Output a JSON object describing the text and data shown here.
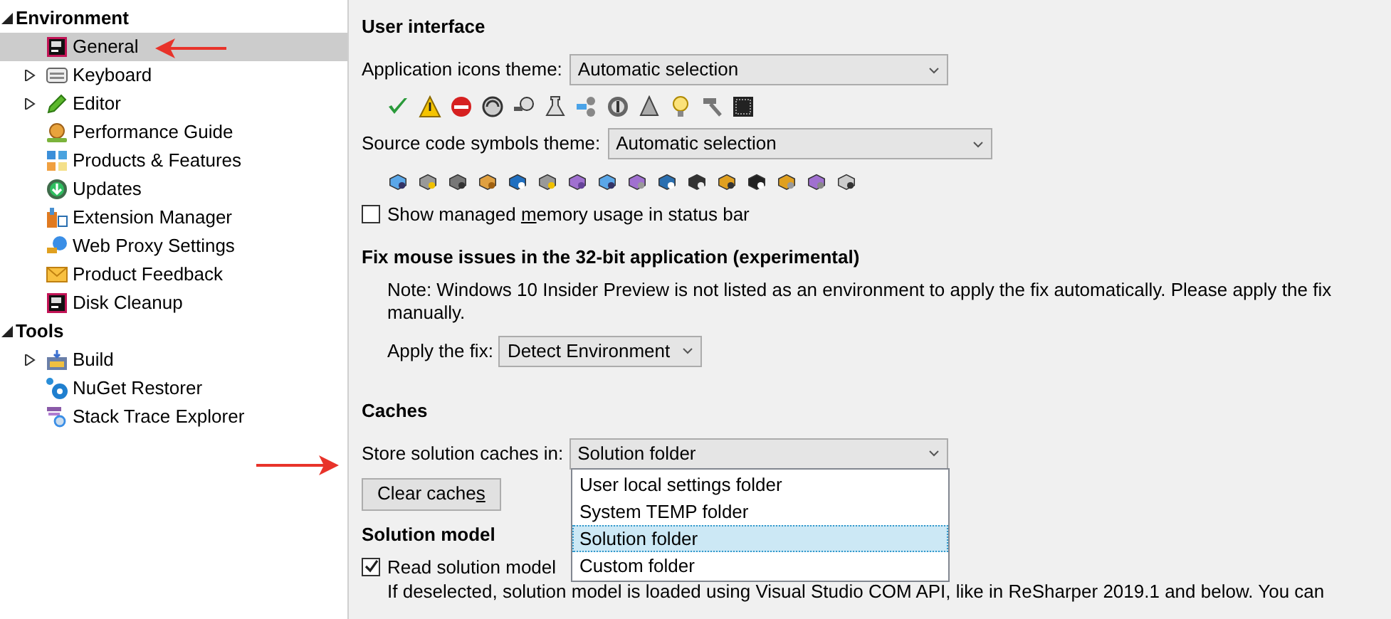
{
  "sidebar": {
    "groups": [
      {
        "label": "Environment",
        "expanded": true,
        "items": [
          {
            "label": "General",
            "selected": true
          },
          {
            "label": "Keyboard",
            "expanded": false,
            "selected": false
          },
          {
            "label": "Editor",
            "expanded": false,
            "selected": false
          },
          {
            "label": "Performance Guide",
            "selected": false
          },
          {
            "label": "Products & Features",
            "selected": false
          },
          {
            "label": "Updates",
            "selected": false
          },
          {
            "label": "Extension Manager",
            "selected": false
          },
          {
            "label": "Web Proxy Settings",
            "selected": false
          },
          {
            "label": "Product Feedback",
            "selected": false
          },
          {
            "label": "Disk Cleanup",
            "selected": false
          }
        ]
      },
      {
        "label": "Tools",
        "expanded": true,
        "items": [
          {
            "label": "Build",
            "expanded": false,
            "selected": false
          },
          {
            "label": "NuGet Restorer",
            "selected": false
          },
          {
            "label": "Stack Trace Explorer",
            "selected": false
          }
        ]
      }
    ]
  },
  "user_interface": {
    "heading": "User interface",
    "app_icons_theme": {
      "label": "Application icons theme:",
      "value": "Automatic selection"
    },
    "source_symbols_theme": {
      "label": "Source code symbols theme:",
      "value": "Automatic selection"
    },
    "memory_checkbox": {
      "label": "Show managed ",
      "accel": "m",
      "label_rest": "emory usage in status bar",
      "checked": false
    }
  },
  "mouse_fix": {
    "heading": "Fix mouse issues in the 32-bit application (experimental)",
    "note": "Note: Windows 10 Insider Preview is not listed as an environment to apply the fix automatically. Please apply the fix manually.",
    "apply": {
      "label": "Apply the fix:",
      "value": "Detect Environment"
    }
  },
  "caches": {
    "heading": "Caches",
    "store": {
      "label": "Store solution caches in:",
      "value": "Solution folder",
      "open": true,
      "options": [
        {
          "label": "User local settings folder",
          "selected": false
        },
        {
          "label": "System TEMP folder",
          "selected": false
        },
        {
          "label": "Solution folder",
          "selected": true
        },
        {
          "label": "Custom folder",
          "selected": false
        }
      ]
    },
    "clear_button": {
      "label": "Clear cache",
      "accel": "s"
    }
  },
  "solution_model": {
    "heading": "Solution model",
    "read_checkbox": {
      "label": "Read solution model",
      "checked": true
    },
    "description": "If deselected, solution model is loaded using Visual Studio COM API, like in ReSharper 2019.1 and below. You can"
  }
}
